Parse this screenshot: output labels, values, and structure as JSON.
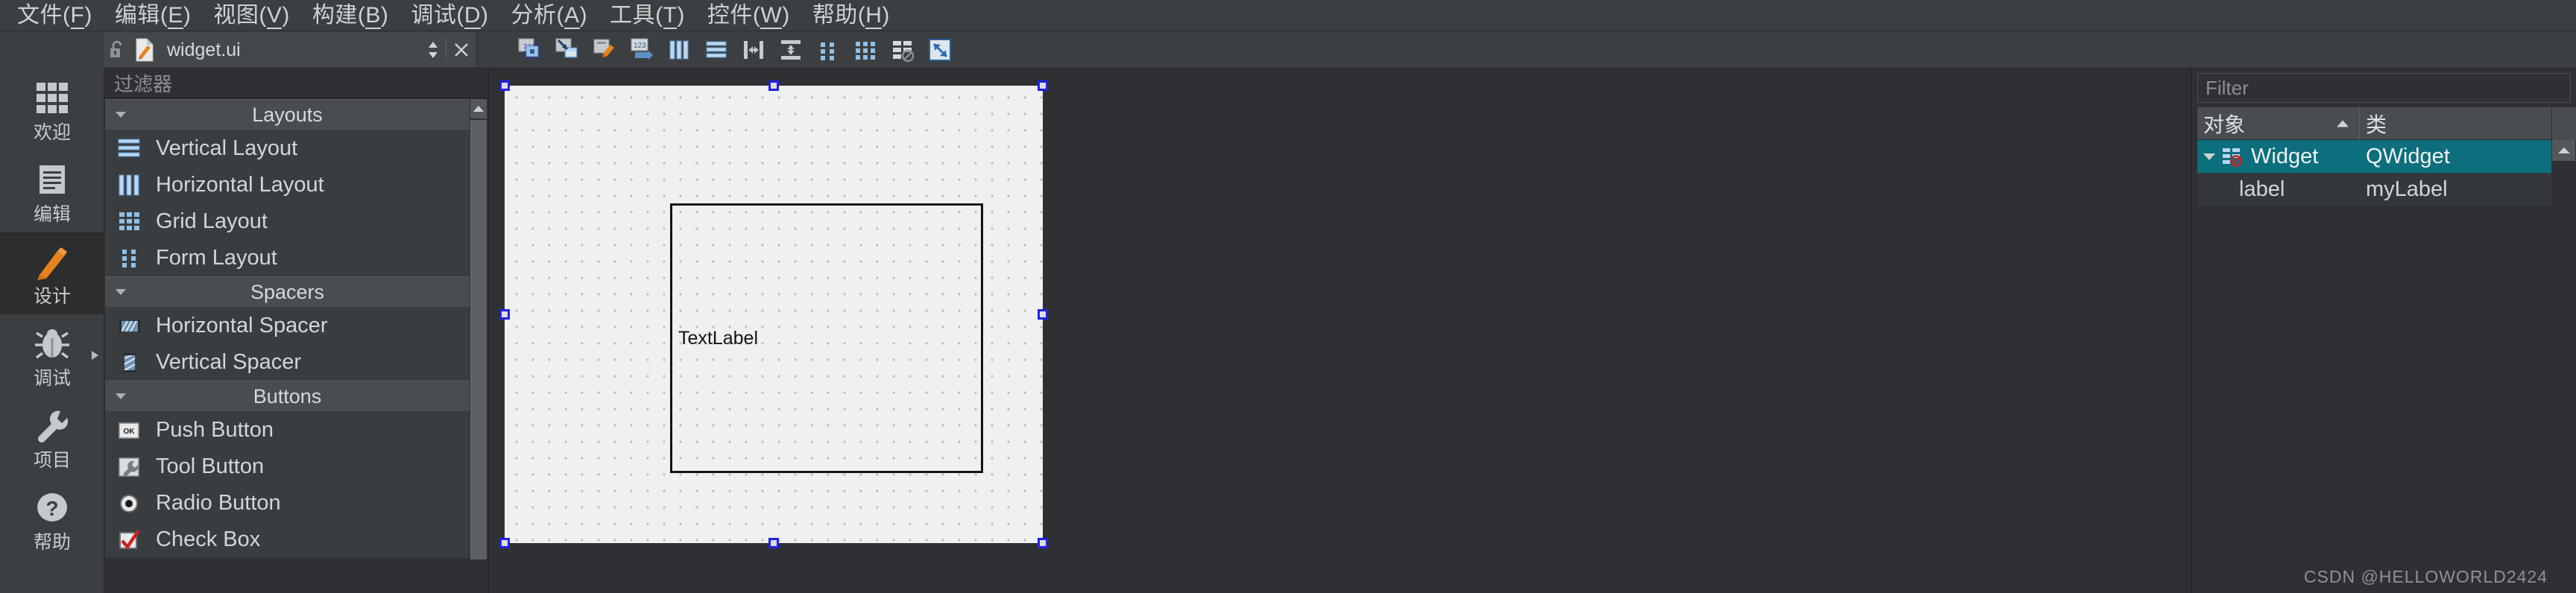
{
  "menubar": {
    "items": [
      {
        "label": "文件",
        "mnemonic": "F"
      },
      {
        "label": "编辑",
        "mnemonic": "E"
      },
      {
        "label": "视图",
        "mnemonic": "V"
      },
      {
        "label": "构建",
        "mnemonic": "B"
      },
      {
        "label": "调试",
        "mnemonic": "D"
      },
      {
        "label": "分析",
        "mnemonic": "A"
      },
      {
        "label": "工具",
        "mnemonic": "T"
      },
      {
        "label": "控件",
        "mnemonic": "W"
      },
      {
        "label": "帮助",
        "mnemonic": "H"
      }
    ]
  },
  "filetab": {
    "name": "widget.ui",
    "lock_icon": "unlocked-padlock-icon",
    "file_icon": "ui-file-pencil-icon",
    "updown_icon": "updown-arrows-icon",
    "close_icon": "close-icon"
  },
  "toolbar": {
    "buttons": [
      {
        "name": "edit-widgets-button",
        "icon": "edit-widgets-icon",
        "tooltip": "Edit Widgets"
      },
      {
        "name": "edit-signals-slots-button",
        "icon": "edit-signals-slots-icon",
        "tooltip": "Edit Signals/Slots"
      },
      {
        "name": "edit-buddies-button",
        "icon": "edit-buddies-icon",
        "tooltip": "Edit Buddies"
      },
      {
        "name": "edit-tab-order-button",
        "icon": "edit-tab-order-icon",
        "tooltip": "Edit Tab Order"
      },
      {
        "name": "layout-horizontally-button",
        "icon": "layout-horizontal-icon",
        "tooltip": "Lay Out Horizontally"
      },
      {
        "name": "layout-vertically-button",
        "icon": "layout-vertical-icon",
        "tooltip": "Lay Out Vertically"
      },
      {
        "name": "layout-splitter-horizontal-button",
        "icon": "splitter-horizontal-icon",
        "tooltip": "Lay Out in a Splitter Horizontally"
      },
      {
        "name": "layout-splitter-vertical-button",
        "icon": "splitter-vertical-icon",
        "tooltip": "Lay Out in a Splitter Vertically"
      },
      {
        "name": "layout-form-button",
        "icon": "form-layout-icon",
        "tooltip": "Lay Out in a Form Layout"
      },
      {
        "name": "layout-grid-button",
        "icon": "grid-layout-icon",
        "tooltip": "Lay Out in a Grid"
      },
      {
        "name": "break-layout-button",
        "icon": "break-layout-icon",
        "tooltip": "Break Layout"
      },
      {
        "name": "adjust-size-button",
        "icon": "adjust-size-icon",
        "tooltip": "Adjust Size"
      }
    ]
  },
  "modebar": {
    "items": [
      {
        "label": "欢迎",
        "icon": "welcome-grid-icon",
        "active": false,
        "has_arrow": false
      },
      {
        "label": "编辑",
        "icon": "edit-document-icon",
        "active": false,
        "has_arrow": false
      },
      {
        "label": "设计",
        "icon": "design-pencil-icon",
        "active": true,
        "has_arrow": false
      },
      {
        "label": "调试",
        "icon": "debug-bug-icon",
        "active": false,
        "has_arrow": true
      },
      {
        "label": "项目",
        "icon": "projects-wrench-icon",
        "active": false,
        "has_arrow": false
      },
      {
        "label": "帮助",
        "icon": "help-question-icon",
        "active": false,
        "has_arrow": false
      }
    ]
  },
  "widgetbox": {
    "filter_placeholder": "过滤器",
    "groups": [
      {
        "title": "Layouts",
        "expanded": true,
        "items": [
          {
            "label": "Vertical Layout",
            "icon": "vertical-layout-icon"
          },
          {
            "label": "Horizontal Layout",
            "icon": "horizontal-layout-icon"
          },
          {
            "label": "Grid Layout",
            "icon": "grid-layout-icon"
          },
          {
            "label": "Form Layout",
            "icon": "form-layout-icon"
          }
        ]
      },
      {
        "title": "Spacers",
        "expanded": true,
        "items": [
          {
            "label": "Horizontal Spacer",
            "icon": "horizontal-spacer-icon"
          },
          {
            "label": "Vertical Spacer",
            "icon": "vertical-spacer-icon"
          }
        ]
      },
      {
        "title": "Buttons",
        "expanded": true,
        "items": [
          {
            "label": "Push Button",
            "icon": "push-button-icon"
          },
          {
            "label": "Tool Button",
            "icon": "tool-button-icon"
          },
          {
            "label": "Radio Button",
            "icon": "radio-button-icon"
          },
          {
            "label": "Check Box",
            "icon": "check-box-icon"
          }
        ]
      }
    ]
  },
  "form": {
    "label_text": "TextLabel",
    "selection_color": "#2020e8",
    "canvas_background": "#eff0f0"
  },
  "inspector": {
    "filter_placeholder": "Filter",
    "columns": [
      {
        "label": "对象",
        "sorted": "ascending"
      },
      {
        "label": "类",
        "sorted": ""
      }
    ],
    "rows": [
      {
        "object": "Widget",
        "class": "QWidget",
        "selected": true,
        "expanded": true,
        "icon": "break-layout-icon",
        "indent": 0
      },
      {
        "object": "label",
        "class": "myLabel",
        "selected": false,
        "expanded": false,
        "icon": "",
        "indent": 1
      }
    ],
    "selection_color": "#0d6f7d"
  },
  "watermark": "CSDN @HELLOWORLD2424"
}
